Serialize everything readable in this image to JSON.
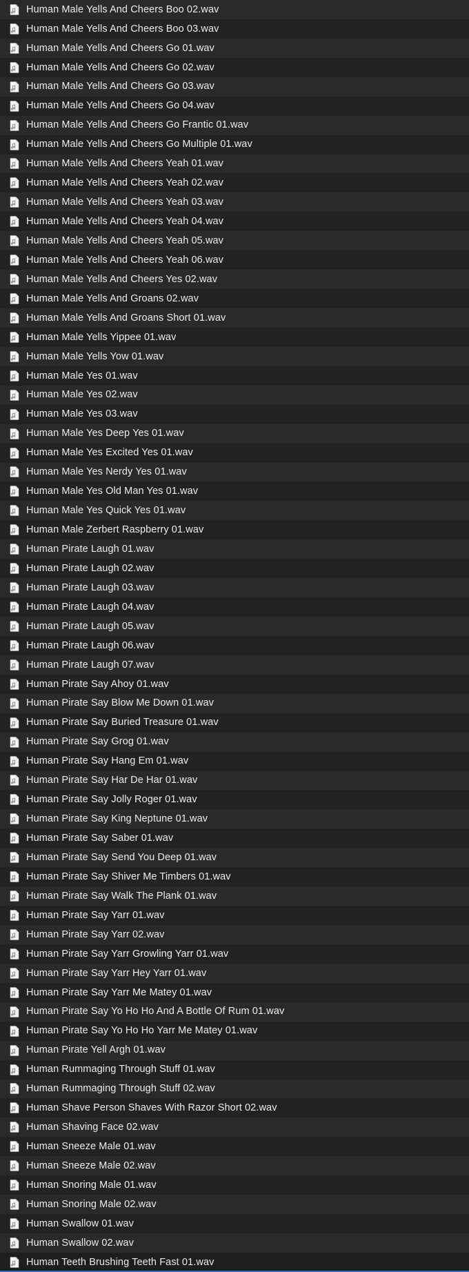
{
  "iconName": "audio-file-icon",
  "files": [
    {
      "name": "Human Male Yells And Cheers Boo 02.wav"
    },
    {
      "name": "Human Male Yells And Cheers Boo 03.wav"
    },
    {
      "name": "Human Male Yells And Cheers Go 01.wav"
    },
    {
      "name": "Human Male Yells And Cheers Go 02.wav"
    },
    {
      "name": "Human Male Yells And Cheers Go 03.wav"
    },
    {
      "name": "Human Male Yells And Cheers Go 04.wav"
    },
    {
      "name": "Human Male Yells And Cheers Go Frantic 01.wav"
    },
    {
      "name": "Human Male Yells And Cheers Go Multiple 01.wav"
    },
    {
      "name": "Human Male Yells And Cheers Yeah 01.wav"
    },
    {
      "name": "Human Male Yells And Cheers Yeah 02.wav"
    },
    {
      "name": "Human Male Yells And Cheers Yeah 03.wav"
    },
    {
      "name": "Human Male Yells And Cheers Yeah 04.wav"
    },
    {
      "name": "Human Male Yells And Cheers Yeah 05.wav"
    },
    {
      "name": "Human Male Yells And Cheers Yeah 06.wav"
    },
    {
      "name": "Human Male Yells And Cheers Yes 02.wav"
    },
    {
      "name": "Human Male Yells And Groans 02.wav"
    },
    {
      "name": "Human Male Yells And Groans Short 01.wav"
    },
    {
      "name": "Human Male Yells Yippee 01.wav"
    },
    {
      "name": "Human Male Yells Yow 01.wav"
    },
    {
      "name": "Human Male Yes 01.wav"
    },
    {
      "name": "Human Male Yes 02.wav"
    },
    {
      "name": "Human Male Yes 03.wav"
    },
    {
      "name": "Human Male Yes Deep Yes 01.wav"
    },
    {
      "name": "Human Male Yes Excited Yes 01.wav"
    },
    {
      "name": "Human Male Yes Nerdy Yes 01.wav"
    },
    {
      "name": "Human Male Yes Old Man Yes 01.wav"
    },
    {
      "name": "Human Male Yes Quick Yes 01.wav"
    },
    {
      "name": "Human Male Zerbert Raspberry 01.wav"
    },
    {
      "name": "Human Pirate Laugh 01.wav"
    },
    {
      "name": "Human Pirate Laugh 02.wav"
    },
    {
      "name": "Human Pirate Laugh 03.wav"
    },
    {
      "name": "Human Pirate Laugh 04.wav"
    },
    {
      "name": "Human Pirate Laugh 05.wav"
    },
    {
      "name": "Human Pirate Laugh 06.wav"
    },
    {
      "name": "Human Pirate Laugh 07.wav"
    },
    {
      "name": "Human Pirate Say Ahoy 01.wav"
    },
    {
      "name": "Human Pirate Say Blow Me Down 01.wav"
    },
    {
      "name": "Human Pirate Say Buried Treasure 01.wav"
    },
    {
      "name": "Human Pirate Say Grog 01.wav"
    },
    {
      "name": "Human Pirate Say Hang Em 01.wav"
    },
    {
      "name": "Human Pirate Say Har De Har 01.wav"
    },
    {
      "name": "Human Pirate Say Jolly Roger 01.wav"
    },
    {
      "name": "Human Pirate Say King Neptune 01.wav"
    },
    {
      "name": "Human Pirate Say Saber 01.wav"
    },
    {
      "name": "Human Pirate Say Send You Deep 01.wav"
    },
    {
      "name": "Human Pirate Say Shiver Me Timbers 01.wav"
    },
    {
      "name": "Human Pirate Say Walk The Plank 01.wav"
    },
    {
      "name": "Human Pirate Say Yarr 01.wav"
    },
    {
      "name": "Human Pirate Say Yarr 02.wav"
    },
    {
      "name": "Human Pirate Say Yarr Growling Yarr 01.wav"
    },
    {
      "name": "Human Pirate Say Yarr Hey Yarr 01.wav"
    },
    {
      "name": "Human Pirate Say Yarr Me Matey 01.wav"
    },
    {
      "name": "Human Pirate Say Yo Ho Ho And A Bottle Of Rum 01.wav"
    },
    {
      "name": "Human Pirate Say Yo Ho Ho Yarr Me Matey 01.wav"
    },
    {
      "name": "Human Pirate Yell Argh 01.wav"
    },
    {
      "name": "Human Rummaging Through Stuff 01.wav"
    },
    {
      "name": "Human Rummaging Through Stuff 02.wav"
    },
    {
      "name": "Human Shave Person Shaves With Razor Short 02.wav"
    },
    {
      "name": "Human Shaving Face 02.wav"
    },
    {
      "name": "Human Sneeze Male 01.wav"
    },
    {
      "name": "Human Sneeze Male 02.wav"
    },
    {
      "name": "Human Snoring Male 01.wav"
    },
    {
      "name": "Human Snoring Male 02.wav"
    },
    {
      "name": "Human Swallow 01.wav"
    },
    {
      "name": "Human Swallow 02.wav"
    },
    {
      "name": "Human Teeth Brushing Teeth Fast 01.wav",
      "selected": true
    }
  ]
}
